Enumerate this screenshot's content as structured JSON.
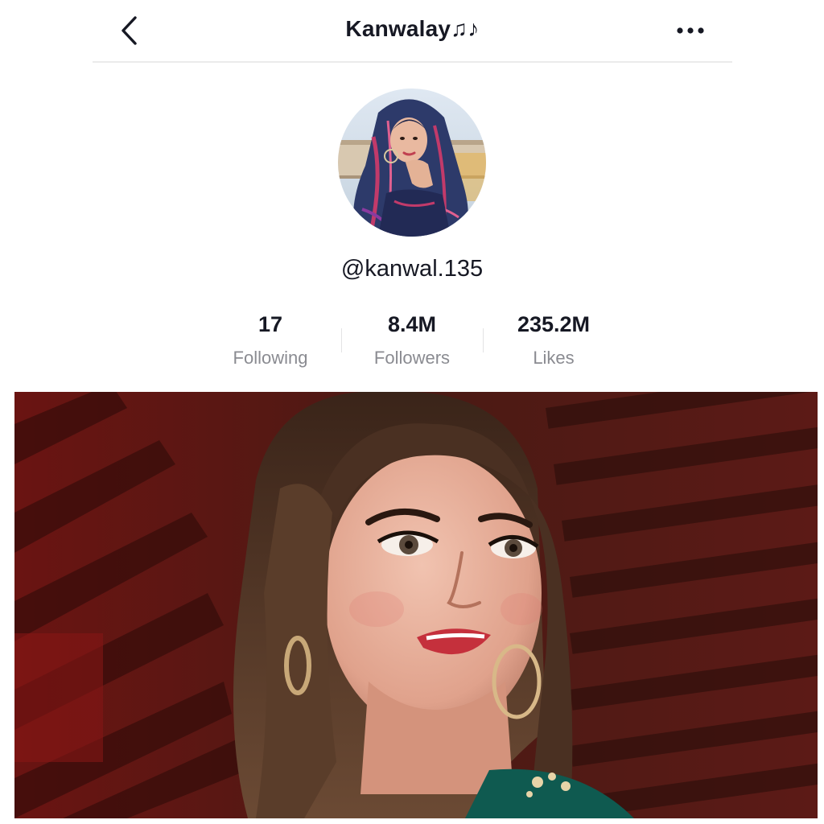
{
  "header": {
    "title": "Kanwalay♫♪",
    "back_icon": "chevron-left-icon",
    "more_icon": "ellipsis-horizontal-icon"
  },
  "profile": {
    "username": "@kanwal.135"
  },
  "stats": [
    {
      "value": "17",
      "label": "Following"
    },
    {
      "value": "8.4M",
      "label": "Followers"
    },
    {
      "value": "235.2M",
      "label": "Likes"
    }
  ],
  "colors": {
    "text_primary": "#161823",
    "text_secondary": "#8a8b91",
    "divider": "#ebebeb",
    "photo_background": "#5a1010",
    "outfit": "#0f5a50"
  }
}
